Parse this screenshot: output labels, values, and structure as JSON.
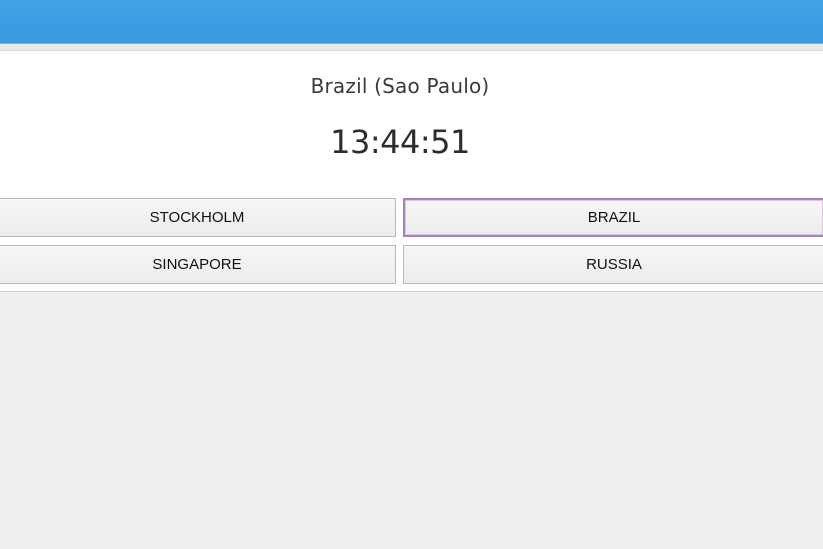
{
  "header": {
    "banner_color": "#3d9ee3"
  },
  "clock_panel": {
    "city_title": "Brazil (Sao Paulo)",
    "time": "13:44:51"
  },
  "city_buttons": [
    {
      "label": "STOCKHOLM",
      "selected": false
    },
    {
      "label": "BRAZIL",
      "selected": true
    },
    {
      "label": "SINGAPORE",
      "selected": false
    },
    {
      "label": "RUSSIA",
      "selected": false
    }
  ],
  "colors": {
    "selected_border": "#a882b6",
    "background": "#efefef"
  }
}
